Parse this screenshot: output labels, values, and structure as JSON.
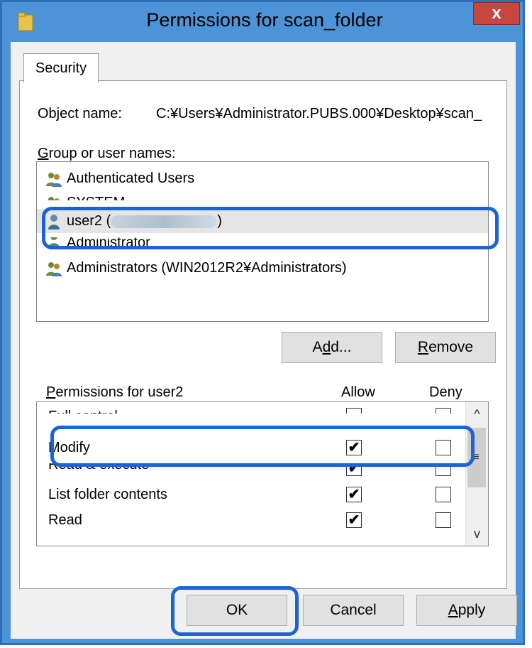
{
  "window": {
    "title": "Permissions for scan_folder",
    "close_label": "x"
  },
  "tabs": [
    {
      "label": "Security"
    }
  ],
  "object": {
    "label": "Object name:",
    "value": "C:¥Users¥Administrator.PUBS.000¥Desktop¥scan_"
  },
  "group_users": {
    "label_prefix": "G",
    "label_rest": "roup or user names:",
    "items": [
      {
        "label": "Authenticated Users",
        "icon": "group-icon"
      },
      {
        "label": "SYSTEM",
        "icon": "group-icon"
      },
      {
        "label": "user2 (",
        "suffix": ")",
        "icon": "user-icon"
      },
      {
        "label": "Administrator",
        "icon": "user-icon"
      },
      {
        "label": "Administrators (WIN2012R2¥Administrators)",
        "icon": "group-icon"
      }
    ]
  },
  "buttons": {
    "add": {
      "pre": "A",
      "under": "d",
      "post": "d..."
    },
    "remove": {
      "pre": "",
      "under": "R",
      "post": "emove"
    },
    "ok": "OK",
    "cancel": "Cancel",
    "apply": {
      "pre": "",
      "under": "A",
      "post": "pply"
    }
  },
  "permissions": {
    "label_under": "P",
    "label_rest": "ermissions for user2",
    "allow_header": "Allow",
    "deny_header": "Deny",
    "rows": [
      {
        "name": "Full control",
        "allow": false,
        "deny": false
      },
      {
        "name": "Modify",
        "allow": true,
        "deny": false
      },
      {
        "name": "Read & execute",
        "allow": true,
        "deny": false
      },
      {
        "name": "List folder contents",
        "allow": true,
        "deny": false
      },
      {
        "name": "Read",
        "allow": true,
        "deny": false
      }
    ],
    "check_glyph": "✔",
    "scroll_up": "^",
    "scroll_down": "v",
    "scroll_grip": "≡"
  },
  "colors": {
    "highlight": "#1a64d6",
    "titlebar": "#4d93d8",
    "close": "#c7463f"
  }
}
